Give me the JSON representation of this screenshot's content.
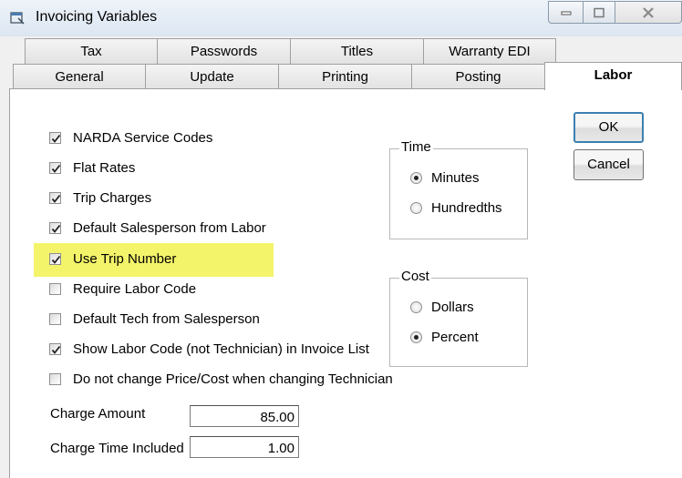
{
  "window": {
    "title": "Invoicing Variables"
  },
  "tabs_back": [
    {
      "label": "Tax"
    },
    {
      "label": "Passwords"
    },
    {
      "label": "Titles"
    },
    {
      "label": "Warranty EDI"
    }
  ],
  "tabs_front": [
    {
      "label": "General"
    },
    {
      "label": "Update"
    },
    {
      "label": "Printing"
    },
    {
      "label": "Posting"
    },
    {
      "label": "Labor",
      "active": true
    }
  ],
  "checkboxes": [
    {
      "label": "NARDA Service Codes",
      "checked": true
    },
    {
      "label": "Flat Rates",
      "checked": true
    },
    {
      "label": "Trip Charges",
      "checked": true
    },
    {
      "label": "Default Salesperson from Labor",
      "checked": true
    },
    {
      "label": "Use Trip Number",
      "checked": true
    },
    {
      "label": "Require Labor Code",
      "checked": false
    },
    {
      "label": "Default Tech from Salesperson",
      "checked": false
    },
    {
      "label": "Show Labor Code (not Technician) in Invoice List",
      "checked": true
    },
    {
      "label": "Do not change Price/Cost when changing Technician",
      "checked": false
    }
  ],
  "time_group": {
    "title": "Time",
    "options": [
      {
        "label": "Minutes",
        "selected": true
      },
      {
        "label": "Hundredths",
        "selected": false
      }
    ]
  },
  "cost_group": {
    "title": "Cost",
    "options": [
      {
        "label": "Dollars",
        "selected": false
      },
      {
        "label": "Percent",
        "selected": true
      }
    ]
  },
  "buttons": {
    "ok": "OK",
    "cancel": "Cancel"
  },
  "fields": {
    "charge_amount": {
      "label": "Charge Amount",
      "value": "85.00"
    },
    "charge_time": {
      "label": "Charge Time Included",
      "value": "1.00"
    }
  },
  "colors": {
    "highlight": "#f4f46a",
    "default_button_border": "#3c7fb1"
  }
}
